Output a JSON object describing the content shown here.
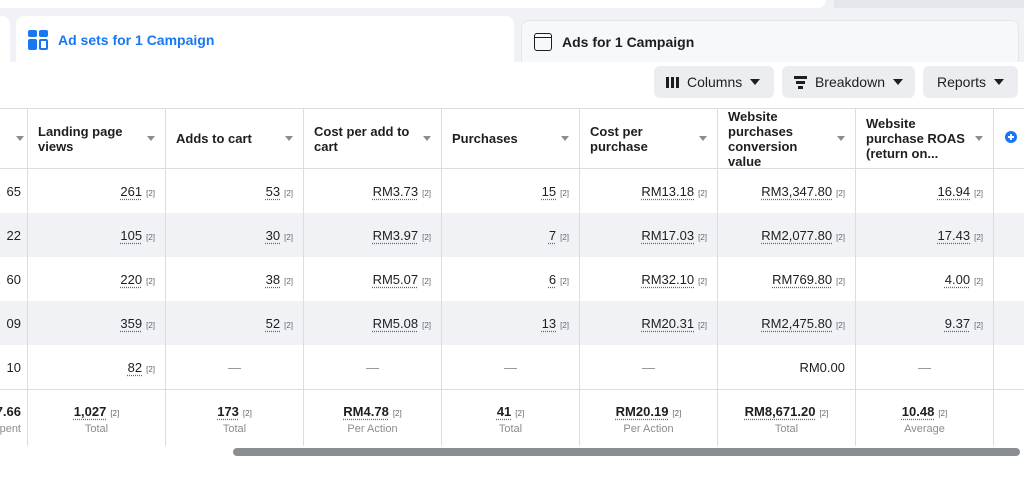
{
  "tabs": {
    "adsets_label": "Ad sets for 1 Campaign",
    "ads_label": "Ads for 1 Campaign"
  },
  "toolbar": {
    "columns_label": "Columns",
    "breakdown_label": "Breakdown",
    "reports_label": "Reports"
  },
  "columns": [
    "Landing page views",
    "Adds to cart",
    "Cost per add to cart",
    "Purchases",
    "Cost per purchase",
    "Website purchases conversion value",
    "Website purchase ROAS (return on..."
  ],
  "ref_marker": "[2]",
  "rows": [
    {
      "first": "65",
      "cells": [
        "261",
        "53",
        "RM3.73",
        "15",
        "RM13.18",
        "RM3,347.80",
        "16.94"
      ]
    },
    {
      "first": "22",
      "cells": [
        "105",
        "30",
        "RM3.97",
        "7",
        "RM17.03",
        "RM2,077.80",
        "17.43"
      ]
    },
    {
      "first": "60",
      "cells": [
        "220",
        "38",
        "RM5.07",
        "6",
        "RM32.10",
        "RM769.80",
        "4.00"
      ]
    },
    {
      "first": "09",
      "cells": [
        "359",
        "52",
        "RM5.08",
        "13",
        "RM20.31",
        "RM2,475.80",
        "9.37"
      ]
    },
    {
      "first": "10",
      "cells": [
        "82",
        "—",
        "—",
        "—",
        "—",
        "RM0.00",
        "—"
      ]
    }
  ],
  "totals": {
    "first": "7.66",
    "first_sub": "pent",
    "cells": [
      "1,027",
      "173",
      "RM4.78",
      "41",
      "RM20.19",
      "RM8,671.20",
      "10.48"
    ],
    "subs": [
      "Total",
      "Total",
      "Per Action",
      "Total",
      "Per Action",
      "Total",
      "Average"
    ]
  },
  "colors": {
    "accent": "#1877f2",
    "row_alt": "#f0f2f5",
    "border": "#dadde1"
  },
  "icons": [
    "adsets-grid-icon",
    "ads-window-icon",
    "columns-icon",
    "breakdown-icon",
    "add-column-icon"
  ]
}
